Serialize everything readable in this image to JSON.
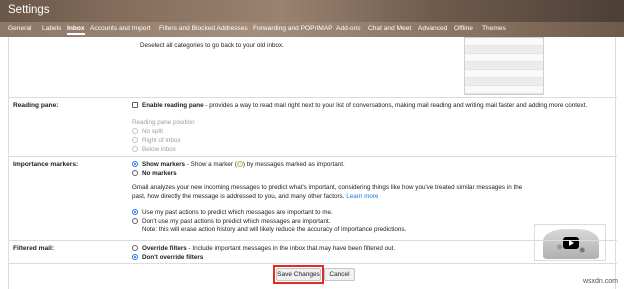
{
  "header": {
    "title": "Settings"
  },
  "tabs": [
    {
      "label": "General"
    },
    {
      "label": "Labels"
    },
    {
      "label": "Inbox"
    },
    {
      "label": "Accounts and Import"
    },
    {
      "label": "Filters and Blocked Addresses"
    },
    {
      "label": "Forwarding and POP/IMAP"
    },
    {
      "label": "Add-ons"
    },
    {
      "label": "Chat and Meet"
    },
    {
      "label": "Advanced"
    },
    {
      "label": "Offline"
    },
    {
      "label": "Themes"
    }
  ],
  "categories_note": "Deselect all categories to go back to your old inbox.",
  "reading_pane": {
    "label": "Reading pane:",
    "checkbox_label": "Enable reading pane",
    "description": " - provides a way to read mail right next to your list of conversations, making mail reading and writing mail faster and adding more context.",
    "position_title": "Reading pane position",
    "options": [
      "No split",
      "Right of inbox",
      "Below inbox"
    ]
  },
  "importance": {
    "label": "Importance markers:",
    "show_label": "Show markers",
    "show_desc_1": " - Show a marker (",
    "show_desc_2": ") by messages marked as important.",
    "no_label": "No markers",
    "para_1": "Gmail analyzes your new incoming messages to predict what's important, considering things like how you've treated similar messages in the",
    "para_2": "past, how directly the message is addressed to you, and many other factors.",
    "learn_more": "Learn more",
    "use_label": "Use my past actions to predict which messages are important to me.",
    "dont_use_label": "Don't use my past actions to predict which messages are important.",
    "note": "Note: this will erase action history and will likely reduce the accuracy of importance predictions."
  },
  "filtered": {
    "label": "Filtered mail:",
    "override_label": "Override filters",
    "override_desc": " - Include important messages in the inbox that may have been filtered out.",
    "dont_override_label": "Don't override filters"
  },
  "buttons": {
    "save": "Save Changes",
    "cancel": "Cancel"
  },
  "watermark": "wsxdn.com",
  "colors": {
    "highlight": "#d93025",
    "accent": "#1a73e8"
  }
}
